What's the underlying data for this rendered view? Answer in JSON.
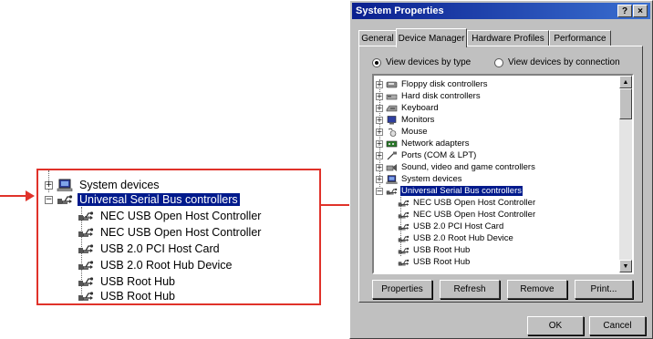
{
  "callout": {
    "items": [
      {
        "label": "System devices",
        "expanded": false,
        "icon": "computer-icon"
      },
      {
        "label": "Universal Serial Bus controllers",
        "expanded": true,
        "selected": true,
        "icon": "usb-icon"
      }
    ],
    "children": [
      "NEC USB Open Host Controller",
      "NEC USB Open Host Controller",
      "USB 2.0 PCI Host Card",
      "USB 2.0 Root Hub Device",
      "USB Root Hub",
      "USB Root Hub"
    ],
    "accent_color": "#e0322a"
  },
  "dialog": {
    "title": "System Properties",
    "help_button": "?",
    "close_button": "×",
    "tabs": [
      "General",
      "Device Manager",
      "Hardware Profiles",
      "Performance"
    ],
    "active_tab": "Device Manager",
    "view_by_type": "View devices by type",
    "view_by_connection": "View devices by connection",
    "tree": [
      {
        "label": "Floppy disk controllers",
        "icon": "floppy-icon"
      },
      {
        "label": "Hard disk controllers",
        "icon": "disk-icon"
      },
      {
        "label": "Keyboard",
        "icon": "keyboard-icon"
      },
      {
        "label": "Monitors",
        "icon": "monitor-icon"
      },
      {
        "label": "Mouse",
        "icon": "mouse-icon"
      },
      {
        "label": "Network adapters",
        "icon": "network-icon"
      },
      {
        "label": "Ports (COM & LPT)",
        "icon": "port-icon"
      },
      {
        "label": "Sound, video and game controllers",
        "icon": "sound-icon"
      },
      {
        "label": "System devices",
        "icon": "computer-icon"
      },
      {
        "label": "Universal Serial Bus controllers",
        "icon": "usb-icon",
        "selected": true,
        "expanded": true
      }
    ],
    "usb_children": [
      "NEC USB Open Host Controller",
      "NEC USB Open Host Controller",
      "USB 2.0 PCI Host Card",
      "USB 2.0 Root Hub Device",
      "USB Root Hub",
      "USB Root Hub"
    ],
    "buttons": {
      "properties": "Properties",
      "refresh": "Refresh",
      "remove": "Remove",
      "print": "Print...",
      "ok": "OK",
      "cancel": "Cancel"
    },
    "selection_color": "#001a8c",
    "title_color": "#0a1f8f"
  }
}
